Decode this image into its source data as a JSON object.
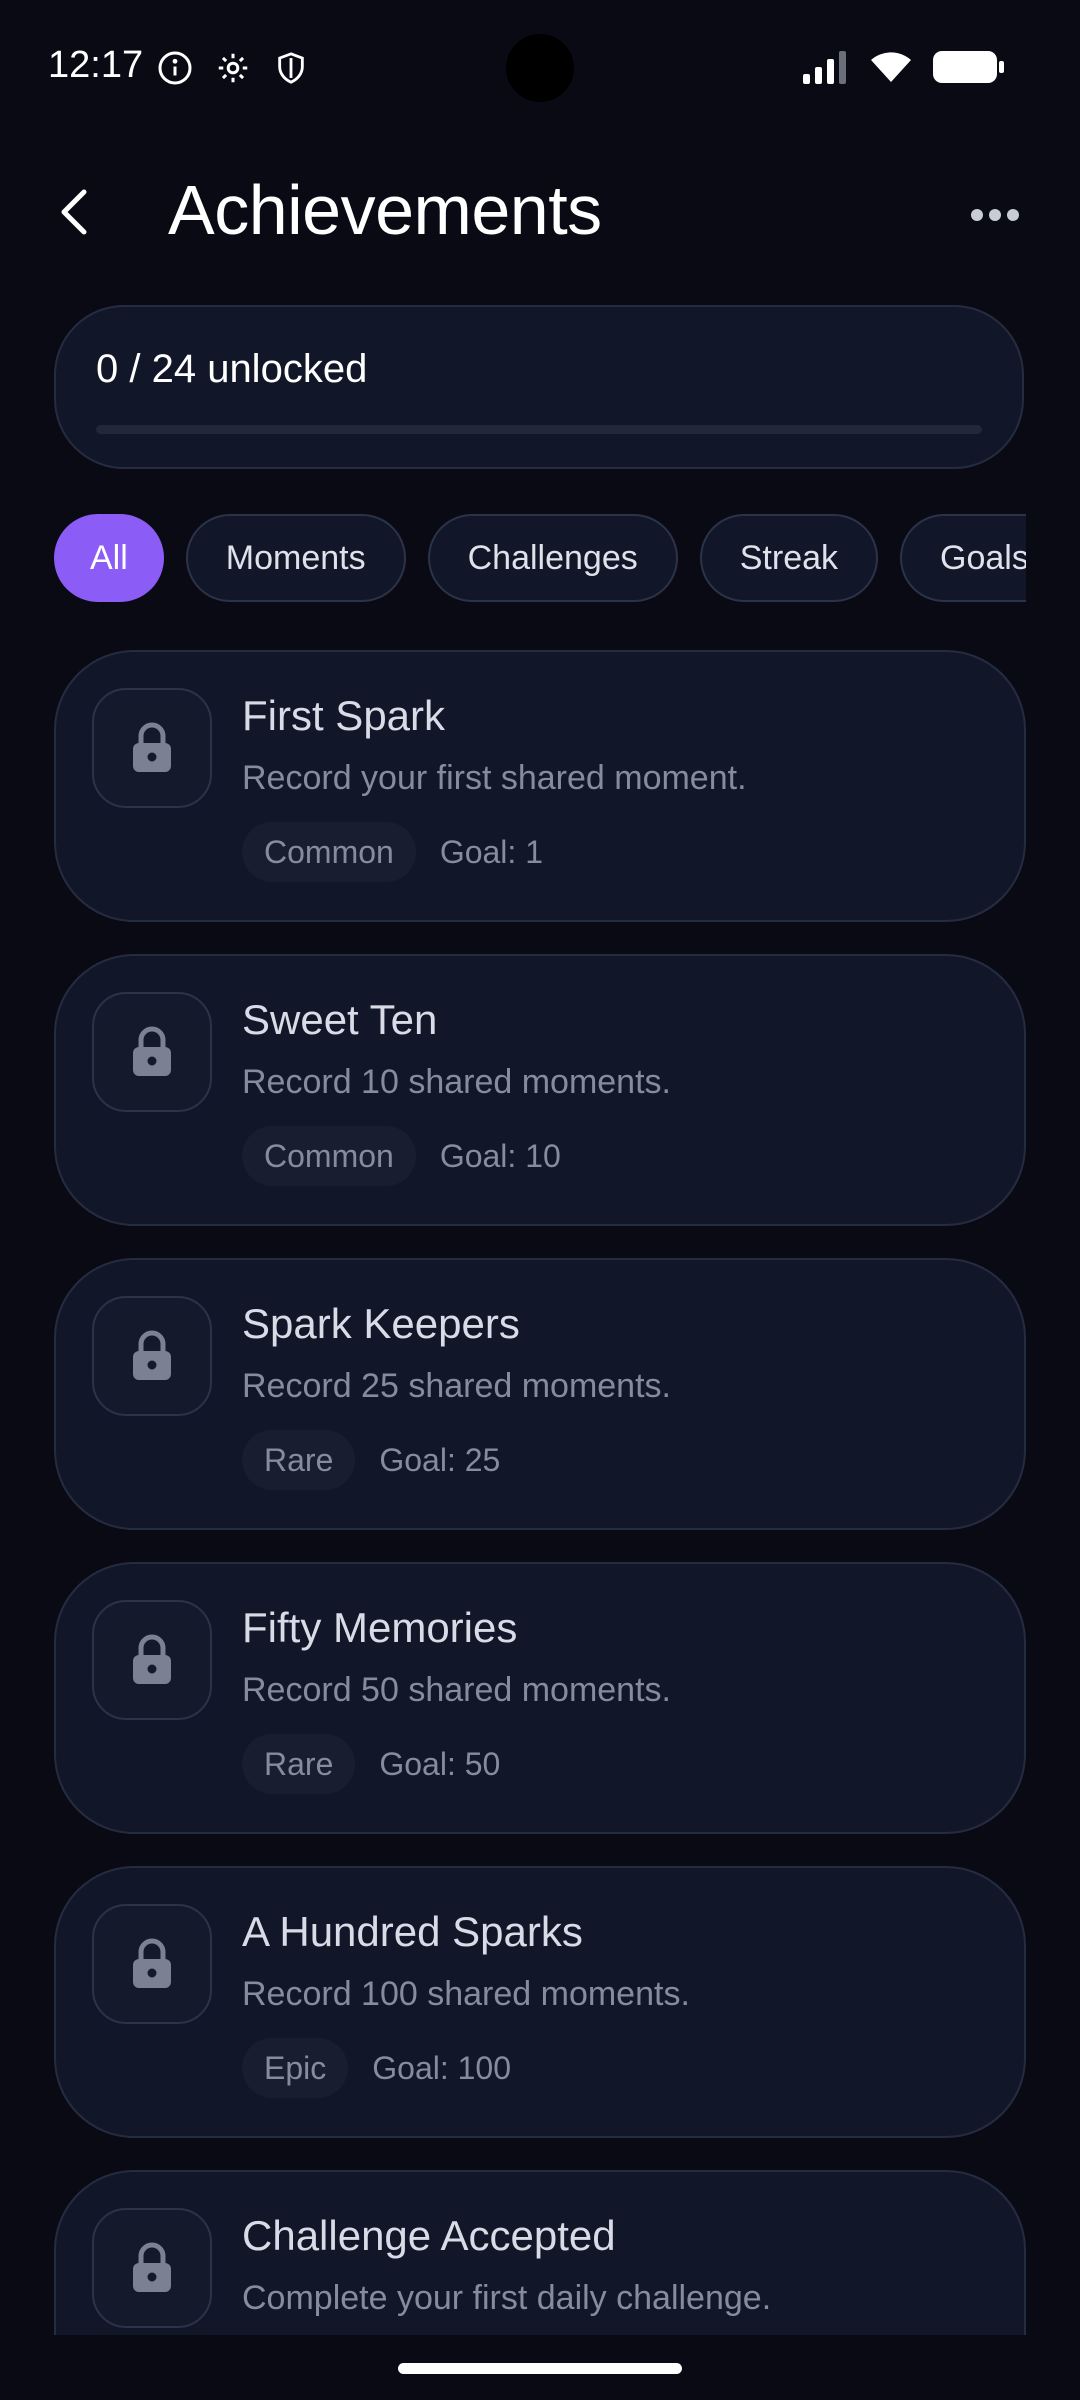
{
  "status_bar": {
    "time": "12:17"
  },
  "header": {
    "title": "Achievements"
  },
  "progress": {
    "label": "0 / 24 unlocked",
    "fraction": 0
  },
  "filters": [
    {
      "label": "All",
      "active": true
    },
    {
      "label": "Moments",
      "active": false
    },
    {
      "label": "Challenges",
      "active": false
    },
    {
      "label": "Streak",
      "active": false
    },
    {
      "label": "Goals",
      "active": false
    }
  ],
  "achievements": [
    {
      "title": "First Spark",
      "description": "Record your first shared moment.",
      "rarity": "Common",
      "goal": "Goal: 1",
      "locked": true
    },
    {
      "title": "Sweet Ten",
      "description": "Record 10 shared moments.",
      "rarity": "Common",
      "goal": "Goal: 10",
      "locked": true
    },
    {
      "title": "Spark Keepers",
      "description": "Record 25 shared moments.",
      "rarity": "Rare",
      "goal": "Goal: 25",
      "locked": true
    },
    {
      "title": "Fifty Memories",
      "description": "Record 50 shared moments.",
      "rarity": "Rare",
      "goal": "Goal: 50",
      "locked": true
    },
    {
      "title": "A Hundred Sparks",
      "description": "Record 100 shared moments.",
      "rarity": "Epic",
      "goal": "Goal: 100",
      "locked": true
    },
    {
      "title": "Challenge Accepted",
      "description": "Complete your first daily challenge.",
      "rarity": "",
      "goal": "",
      "locked": true
    }
  ],
  "colors": {
    "background": "#0a0a14",
    "card": "#111729",
    "accent": "#8b5cf6"
  },
  "icons": {
    "back": "chevron-left-icon",
    "more": "more-horizontal-icon",
    "lock": "lock-icon"
  }
}
